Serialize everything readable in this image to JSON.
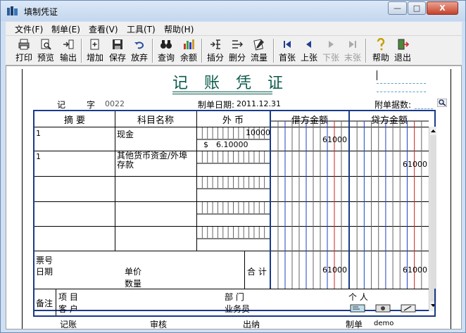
{
  "window": {
    "title": "填制凭证",
    "minimize": "—",
    "maximize": "□",
    "close": "X"
  },
  "menu": [
    "文件(F)",
    "制单(E)",
    "查看(V)",
    "工具(T)",
    "帮助(H)"
  ],
  "toolbar": [
    {
      "label": "打印",
      "icon": "printer-icon"
    },
    {
      "label": "预览",
      "icon": "preview-icon"
    },
    {
      "label": "输出",
      "icon": "export-icon"
    },
    {
      "label": "增加",
      "icon": "add-icon"
    },
    {
      "label": "保存",
      "icon": "save-icon"
    },
    {
      "label": "放弃",
      "icon": "undo-icon"
    },
    {
      "label": "查询",
      "icon": "binoculars-icon"
    },
    {
      "label": "余额",
      "icon": "balance-chart-icon"
    },
    {
      "label": "插分",
      "icon": "insert-row-icon"
    },
    {
      "label": "删分",
      "icon": "delete-row-icon"
    },
    {
      "label": "流量",
      "icon": "cashflow-icon"
    },
    {
      "label": "首张",
      "icon": "first-icon"
    },
    {
      "label": "上张",
      "icon": "prev-icon"
    },
    {
      "label": "下张",
      "icon": "next-icon"
    },
    {
      "label": "末张",
      "icon": "last-icon"
    },
    {
      "label": "帮助",
      "icon": "help-icon"
    },
    {
      "label": "退出",
      "icon": "exit-icon"
    }
  ],
  "voucher": {
    "title": "记 账 凭 证",
    "type_label": "记",
    "zi_label": "字",
    "number": "0022",
    "date_label": "制单日期:",
    "date": "2011.12.31",
    "attach_label": "附单据数:",
    "columns": {
      "summary": "摘 要",
      "account": "科目名称",
      "foreign": "外 币",
      "debit": "借方金额",
      "credit": "贷方金额"
    },
    "rows": [
      {
        "summary": "1",
        "account": "现金",
        "fc_amount": "10000",
        "fc_currency": "$",
        "fc_rate": "6.10000",
        "debit": "61000",
        "credit": ""
      },
      {
        "summary": "1",
        "account": "其他货币资金/外埠存款",
        "fc_amount": "",
        "fc_currency": "",
        "fc_rate": "",
        "debit": "",
        "credit": "61000"
      }
    ],
    "ticket_label": "票号",
    "date2_label": "日期",
    "price_label": "单价",
    "qty_label": "数量",
    "total_label": "合 计",
    "total_debit": "61000",
    "total_credit": "61000",
    "note_label": "备注",
    "project_label": "项  目",
    "customer_label": "客  户",
    "dept_label": "部  门",
    "person_label": "个  人",
    "salesman_label": "业务员",
    "signs": {
      "post": "记账",
      "audit": "审核",
      "cashier": "出纳",
      "maker": "制单",
      "maker_name": "demo"
    }
  }
}
